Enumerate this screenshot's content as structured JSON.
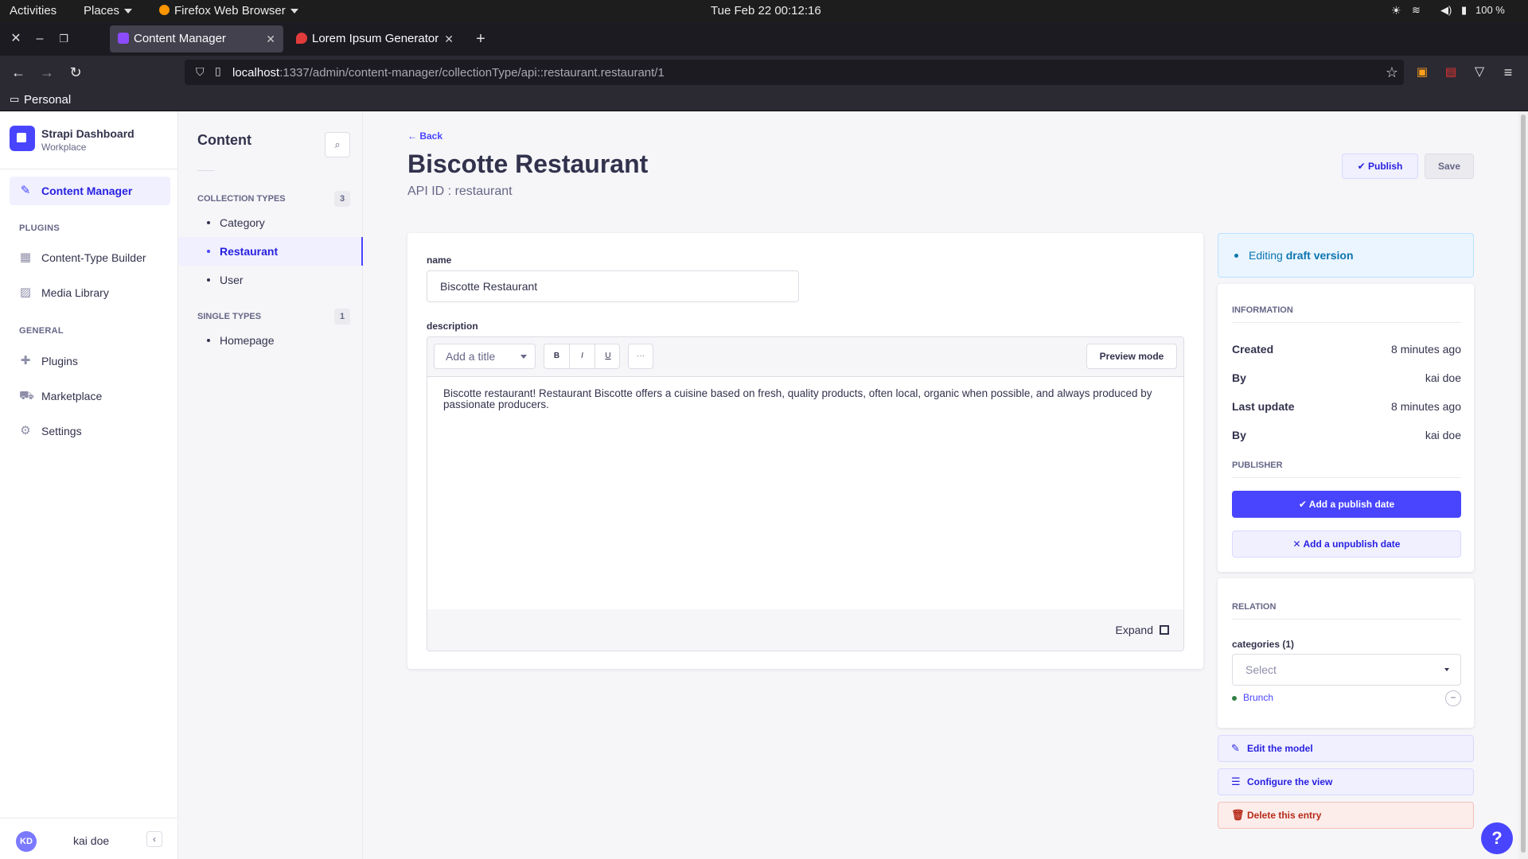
{
  "system": {
    "activities": "Activities",
    "places": "Places",
    "app_name": "Firefox Web Browser",
    "datetime": "Tue Feb 22  00:12:16",
    "battery": "100 %"
  },
  "browser": {
    "tabs": [
      {
        "label": "Content Manager",
        "active": true
      },
      {
        "label": "Lorem Ipsum Generator",
        "active": false
      }
    ],
    "new_tab": "+",
    "url_host": "localhost",
    "url_path": ":1337/admin/content-manager/collectionType/api::restaurant.restaurant/1",
    "bookmark_folder": "Personal"
  },
  "leftnav": {
    "brand_title": "Strapi Dashboard",
    "brand_sub": "Workplace",
    "content_manager": "Content Manager",
    "plugins_header": "PLUGINS",
    "plugins": [
      "Content-Type Builder",
      "Media Library"
    ],
    "general_header": "GENERAL",
    "general": [
      "Plugins",
      "Marketplace",
      "Settings"
    ],
    "user_initials": "KD",
    "user_name": "kai doe"
  },
  "subnav": {
    "title": "Content",
    "collection_header": "COLLECTION TYPES",
    "collection_count": "3",
    "collection_items": [
      "Category",
      "Restaurant",
      "User"
    ],
    "single_header": "SINGLE TYPES",
    "single_count": "1",
    "single_items": [
      "Homepage"
    ]
  },
  "entry": {
    "back": "Back",
    "title": "Biscotte Restaurant",
    "api_id": "API ID : restaurant",
    "publish": "Publish",
    "save": "Save",
    "name_label": "name",
    "name_value": "Biscotte Restaurant",
    "description_label": "description",
    "title_select": "Add a title",
    "bold": "B",
    "italic": "I",
    "underline": "U",
    "more": "···",
    "preview_mode": "Preview mode",
    "description": "Biscotte restaurant! Restaurant Biscotte offers a cuisine based on fresh, quality products, often local, organic when possible, and always produced by passionate producers.",
    "expand": "Expand"
  },
  "sidebar": {
    "editing_prefix": "Editing",
    "editing_version": "draft version",
    "information_header": "INFORMATION",
    "created_label": "Created",
    "created_value": "8 minutes ago",
    "by_label": "By",
    "created_by": "kai doe",
    "updated_label": "Last update",
    "updated_value": "8 minutes ago",
    "updated_by": "kai doe",
    "publisher_header": "PUBLISHER",
    "add_publish_date": "Add a publish date",
    "add_unpublish_date": "Add a unpublish date",
    "relation_header": "RELATION",
    "categories_label": "categories (1)",
    "select_placeholder": "Select",
    "relation_item": "Brunch",
    "edit_model": "Edit the model",
    "configure_view": "Configure the view",
    "delete_entry": "Delete this entry"
  },
  "help": "?"
}
